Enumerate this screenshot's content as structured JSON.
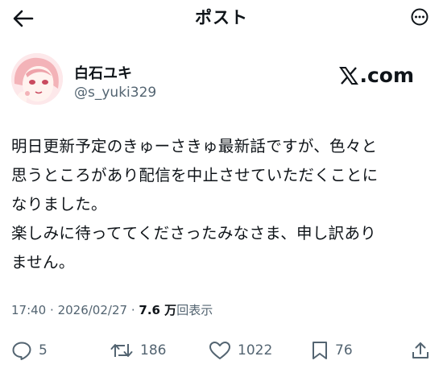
{
  "header": {
    "title": "ポスト",
    "back_icon": "arrow-left-icon",
    "more_icon": "more-dots-icon"
  },
  "author": {
    "display_name": "白石ユキ",
    "handle": "@s_yuki329",
    "avatar_icon": "avatar-illustration"
  },
  "brand": {
    "wordmark": "X.com",
    "wordmark_rest": ".com"
  },
  "post": {
    "lines": [
      "明日更新予定のきゅーさきゅ最新話ですが、色々と",
      "思うところがあり配信を中止させていただくことに",
      "なりました。",
      "楽しみに待っててくださったみなさま、申し訳あり",
      "ません。"
    ]
  },
  "meta": {
    "time": "17:40",
    "separator": "·",
    "date": "2026/02/27",
    "views_count": "7.6 万",
    "views_label": "回表示"
  },
  "actions": {
    "reply_count": "5",
    "repost_count": "186",
    "like_count": "1022",
    "bookmark_count": "76"
  },
  "colors": {
    "text": "#0f1419",
    "secondary": "#536471",
    "background": "#ffffff"
  }
}
